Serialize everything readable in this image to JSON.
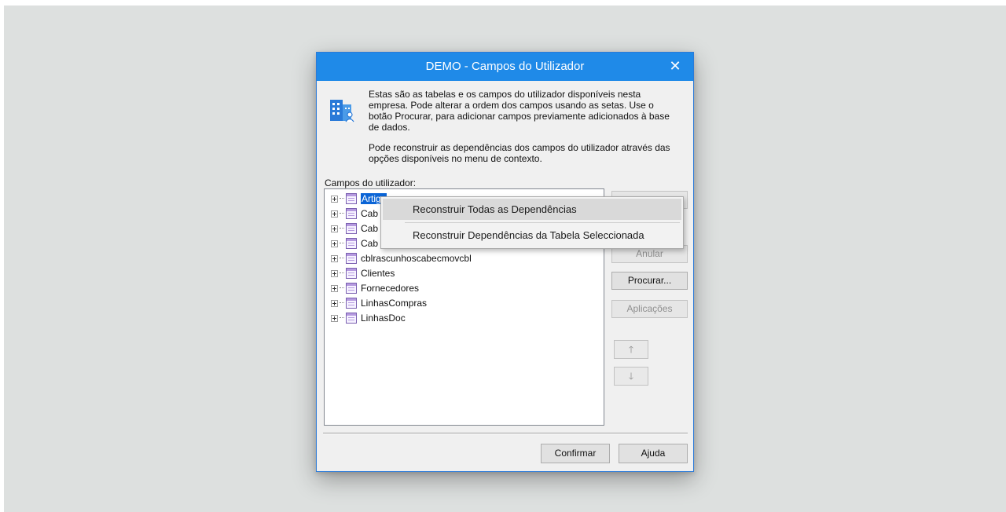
{
  "window": {
    "title": "DEMO - Campos do Utilizador",
    "close_glyph": "✕"
  },
  "info": {
    "icon": "building-user-icon",
    "paragraph1": "Estas são as tabelas e os campos do utilizador disponíveis nesta empresa. Pode alterar a ordem dos campos usando as setas. Use o botão Procurar, para adicionar campos previamente adicionados à base de dados.",
    "paragraph2": "Pode reconstruir as dependências dos campos do utilizador através das opções disponíveis no menu de contexto."
  },
  "list_label": "Campos do utilizador:",
  "tree": {
    "items": [
      {
        "label": "Artigo",
        "selected": true
      },
      {
        "label": "Cab"
      },
      {
        "label": "Cab"
      },
      {
        "label": "Cab"
      },
      {
        "label": "cblrascunhoscabecmovcbl"
      },
      {
        "label": "Clientes"
      },
      {
        "label": "Fornecedores"
      },
      {
        "label": "LinhasCompras"
      },
      {
        "label": "LinhasDoc"
      }
    ]
  },
  "side_buttons": {
    "anular": "Anular",
    "procurar": "Procurar...",
    "aplicacoes": "Aplicações",
    "up_glyph": "🡑",
    "down_glyph": "🡓"
  },
  "footer": {
    "confirmar": "Confirmar",
    "ajuda": "Ajuda"
  },
  "context_menu": {
    "items": [
      {
        "label": "Reconstruir Todas as Dependências",
        "hover": true
      },
      {
        "label": "Reconstruir Dependências da Tabela Seleccionada"
      }
    ]
  },
  "colors": {
    "titlebar": "#1f8ae8",
    "selection": "#0a64d6",
    "background": "#dde0df"
  }
}
